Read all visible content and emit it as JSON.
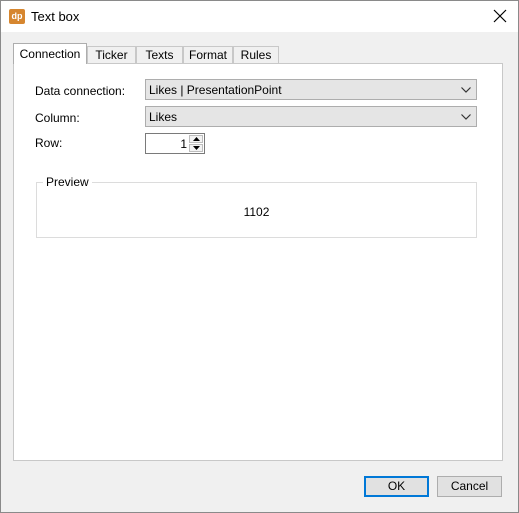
{
  "window": {
    "title": "Text box",
    "app_icon_text": "dp",
    "app_icon_color": "#d6862f"
  },
  "tabs": [
    {
      "label": "Connection",
      "active": true
    },
    {
      "label": "Ticker",
      "active": false
    },
    {
      "label": "Texts",
      "active": false
    },
    {
      "label": "Format",
      "active": false
    },
    {
      "label": "Rules",
      "active": false
    }
  ],
  "connection": {
    "data_connection_label": "Data connection:",
    "data_connection_value": "Likes | PresentationPoint",
    "column_label": "Column:",
    "column_value": "Likes",
    "row_label": "Row:",
    "row_value": "1"
  },
  "preview": {
    "title": "Preview",
    "value": "1102"
  },
  "buttons": {
    "ok": "OK",
    "cancel": "Cancel"
  }
}
